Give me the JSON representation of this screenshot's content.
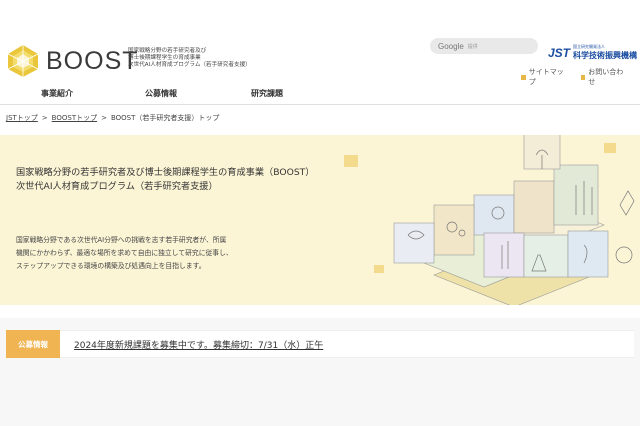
{
  "header": {
    "logo_text": "BOOST",
    "logo_subtitle_lines": [
      "国家戦略分野の若手研究者及び",
      "博士後期課程学生の育成事業",
      "次世代AI人材育成プログラム（若手研究者支援）"
    ],
    "search": {
      "brand": "Google",
      "hint": "提供"
    },
    "org": {
      "mark": "JST",
      "small_name": "国立研究開発法人",
      "big_name": "科学技術振興機構"
    },
    "util_links": [
      "サイトマップ",
      "お問い合わせ"
    ],
    "accent_color": "#e6b84a"
  },
  "nav": {
    "items": [
      "事業紹介",
      "公募情報",
      "研究課題"
    ]
  },
  "breadcrumb": {
    "items": [
      "JSTトップ",
      "BOOSTトップ"
    ],
    "current": "BOOST（若手研究者支援）トップ",
    "separator": ">"
  },
  "hero": {
    "title_lines": [
      "国家戦略分野の若手研究者及び博士後期課程学生の育成事業（BOOST）",
      "次世代AI人材育成プログラム（若手研究者支援）"
    ],
    "desc_lines": [
      "国家戦略分野である次世代AI分野への挑戦を志す若手研究者が、所属",
      "機関にかかわらず、最適な場所を求めて自由に独立して研究に従事し、",
      "ステップアップできる環境の構築及び処遇向上を目指します。"
    ],
    "background_color": "#fbf5d6"
  },
  "news": {
    "tag": "公募情報",
    "text": "2024年度新規課題を募集中です。募集締切：7/31（水）正午",
    "tag_color": "#f0b552"
  }
}
